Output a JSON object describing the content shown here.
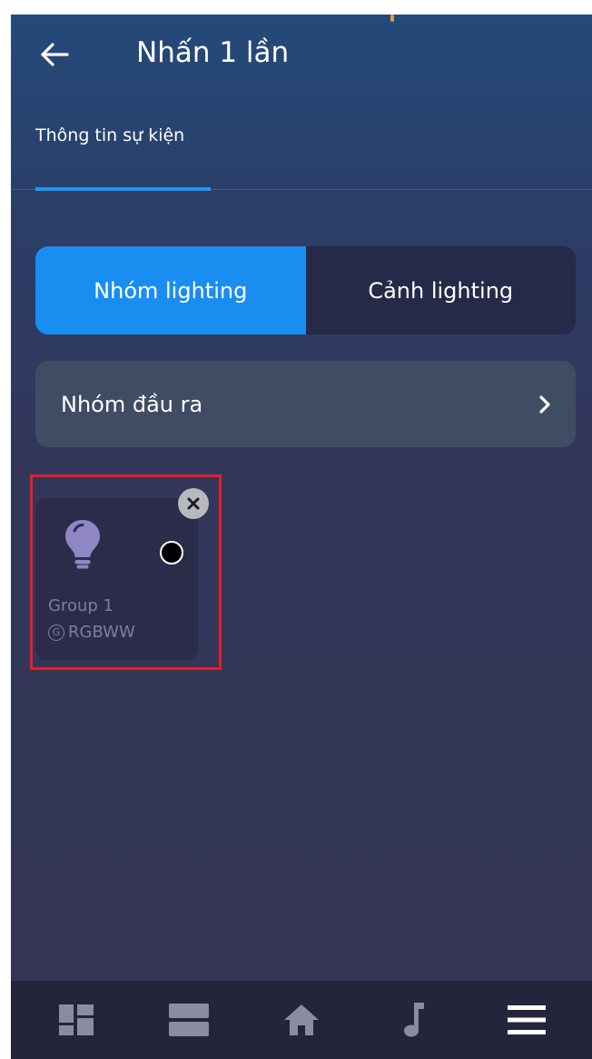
{
  "header": {
    "title": "Nhấn 1 lần",
    "back_icon": "arrow-left-icon"
  },
  "tabs": [
    {
      "label": "Thông tin sự kiện",
      "active": true
    }
  ],
  "segmented": {
    "options": [
      {
        "label": "Nhóm lighting",
        "selected": true
      },
      {
        "label": "Cảnh lighting",
        "selected": false
      }
    ]
  },
  "output_group": {
    "label": "Nhóm đầu ra",
    "chevron_icon": "chevron-right-icon"
  },
  "device_card": {
    "name": "Group 1",
    "type": "RGBWW",
    "type_prefix_glyph": "G",
    "icon": "lightbulb-icon",
    "status": "off"
  },
  "colors": {
    "accent": "#1a8ef0",
    "highlight_border": "#e2202a",
    "row_bg": "#3f4c63",
    "bulb": "#8e87c4"
  },
  "bottom_nav": {
    "items": [
      {
        "icon": "dashboard-icon"
      },
      {
        "icon": "rooms-icon"
      },
      {
        "icon": "home-icon"
      },
      {
        "icon": "music-icon"
      },
      {
        "icon": "menu-icon"
      }
    ]
  }
}
